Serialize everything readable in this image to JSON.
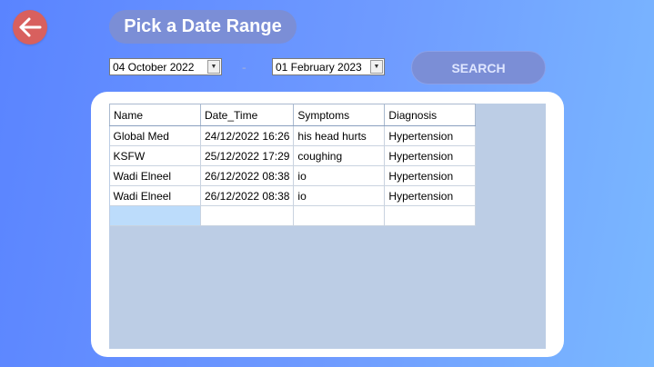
{
  "header": {
    "title": "Pick a Date Range"
  },
  "filters": {
    "from_date": "04 October 2022",
    "to_date": "01 February 2023",
    "separator": "-",
    "search_label": "SEARCH"
  },
  "grid": {
    "columns": [
      "Name",
      "Date_Time",
      "Symptoms",
      "Diagnosis"
    ],
    "rows": [
      [
        "Global Med",
        "24/12/2022 16:26",
        "his head hurts",
        "Hypertension"
      ],
      [
        "KSFW",
        "25/12/2022 17:29",
        "coughing",
        "Hypertension"
      ],
      [
        "Wadi Elneel",
        "26/12/2022 08:38",
        "io",
        "Hypertension"
      ],
      [
        "Wadi Elneel",
        "26/12/2022 08:38",
        "io",
        "Hypertension"
      ],
      [
        "",
        "",
        "",
        ""
      ]
    ]
  },
  "colors": {
    "back_button": "#d8605e",
    "pill": "#7b8ed6",
    "grid_background": "#bccde5",
    "selected_cell": "#bcdcfb"
  },
  "icons": {
    "back": "arrow-left-icon",
    "dropdown": "chevron-down-icon"
  }
}
